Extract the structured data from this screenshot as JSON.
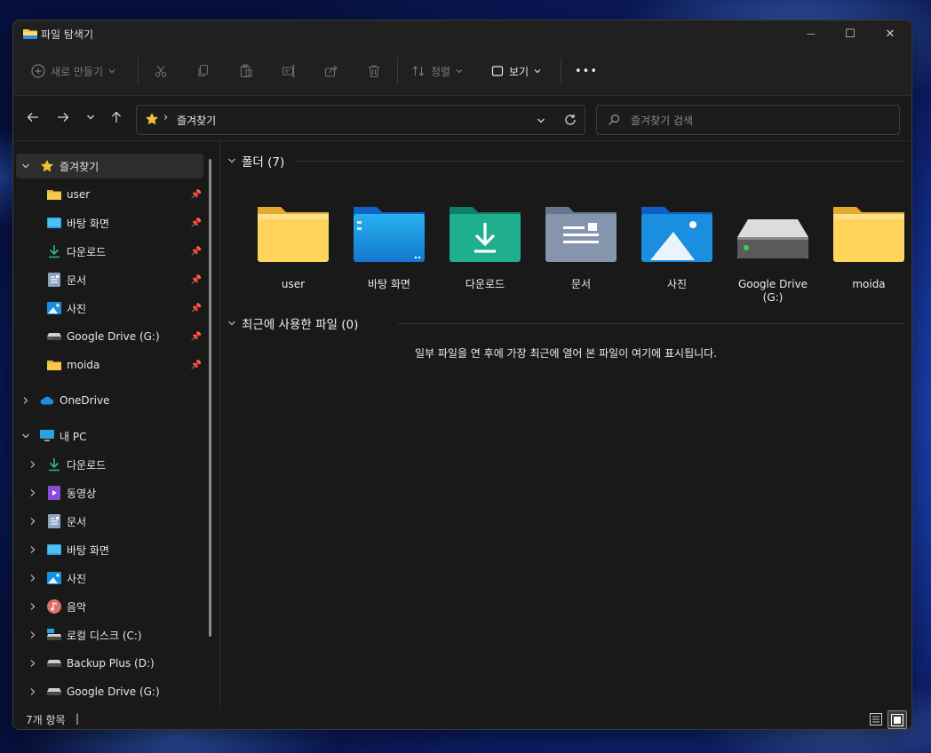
{
  "window": {
    "title": "파일 탐색기",
    "minimize_glyph": "—",
    "maximize_glyph": "☐",
    "close_glyph": "✕"
  },
  "toolbar": {
    "new_label": "새로 만들기",
    "sort_label": "정렬",
    "view_label": "보기",
    "more_label": "•••"
  },
  "address": {
    "current": "즐겨찾기",
    "separator": "›",
    "search_placeholder": "즐겨찾기 검색"
  },
  "sidebar": {
    "quick_access": {
      "label": "즐겨찾기",
      "items": [
        {
          "label": "user",
          "icon": "folder-yellow-icon",
          "pinned": true
        },
        {
          "label": "바탕 화면",
          "icon": "desktop-icon",
          "pinned": true
        },
        {
          "label": "다운로드",
          "icon": "download-icon",
          "pinned": true
        },
        {
          "label": "문서",
          "icon": "documents-icon",
          "pinned": true
        },
        {
          "label": "사진",
          "icon": "pictures-icon",
          "pinned": true
        },
        {
          "label": "Google Drive (G:)",
          "icon": "drive-icon",
          "pinned": true
        },
        {
          "label": "moida",
          "icon": "folder-yellow-icon",
          "pinned": true
        }
      ]
    },
    "onedrive": {
      "label": "OneDrive"
    },
    "this_pc": {
      "label": "내 PC",
      "items": [
        {
          "label": "다운로드",
          "icon": "download-icon"
        },
        {
          "label": "동영상",
          "icon": "videos-icon"
        },
        {
          "label": "문서",
          "icon": "documents-icon"
        },
        {
          "label": "바탕 화면",
          "icon": "desktop-icon"
        },
        {
          "label": "사진",
          "icon": "pictures-icon"
        },
        {
          "label": "음악",
          "icon": "music-icon"
        },
        {
          "label": "로컬 디스크 (C:)",
          "icon": "local-disk-icon"
        },
        {
          "label": "Backup Plus (D:)",
          "icon": "drive-icon"
        },
        {
          "label": "Google Drive (G:)",
          "icon": "drive-icon"
        }
      ]
    }
  },
  "content": {
    "folders_header": "폴더 (7)",
    "folders": [
      {
        "label": "user",
        "icon": "folder-yellow-icon"
      },
      {
        "label": "바탕 화면",
        "icon": "desktop-folder-icon"
      },
      {
        "label": "다운로드",
        "icon": "download-folder-icon"
      },
      {
        "label": "문서",
        "icon": "documents-folder-icon"
      },
      {
        "label": "사진",
        "icon": "pictures-folder-icon"
      },
      {
        "label": "Google Drive (G:)",
        "icon": "drive-icon"
      },
      {
        "label": "moida",
        "icon": "folder-yellow-icon"
      }
    ],
    "recent_header": "최근에 사용한 파일 (0)",
    "recent_empty": "일부 파일을 연 후에 가장 최근에 열어 본 파일이 여기에 표시됩니다."
  },
  "status": {
    "count": "7개 항목",
    "separator": "|"
  },
  "colors": {
    "window_bg": "#191919",
    "toolbar_bg": "#202020",
    "folder_yellow": "#f8c84a",
    "star": "#f2c232",
    "accent_blue": "#1a8fe0"
  }
}
